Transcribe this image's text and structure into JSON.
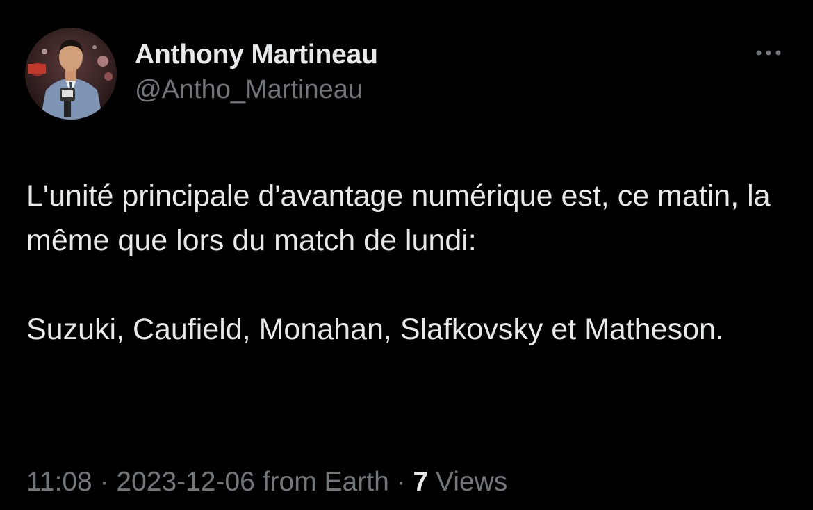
{
  "author": {
    "display_name": "Anthony Martineau",
    "handle": "@Antho_Martineau",
    "avatar_icon": "profile-photo"
  },
  "menu": {
    "icon": "more-dots-icon"
  },
  "tweet": {
    "line1": "L'unité principale d'avantage numérique est, ce matin, la même que lors du match de lundi:",
    "line2": "Suzuki, Caufield, Monahan, Slafkovsky et Matheson."
  },
  "meta": {
    "time": "11:08",
    "sep1": " · ",
    "date": "2023-12-06",
    "source": " from Earth",
    "sep2": " · ",
    "views_count": "7",
    "views_label": " Views"
  },
  "colors": {
    "background": "#000000",
    "primary_text": "#e7e9ea",
    "secondary_text": "#71767b"
  }
}
